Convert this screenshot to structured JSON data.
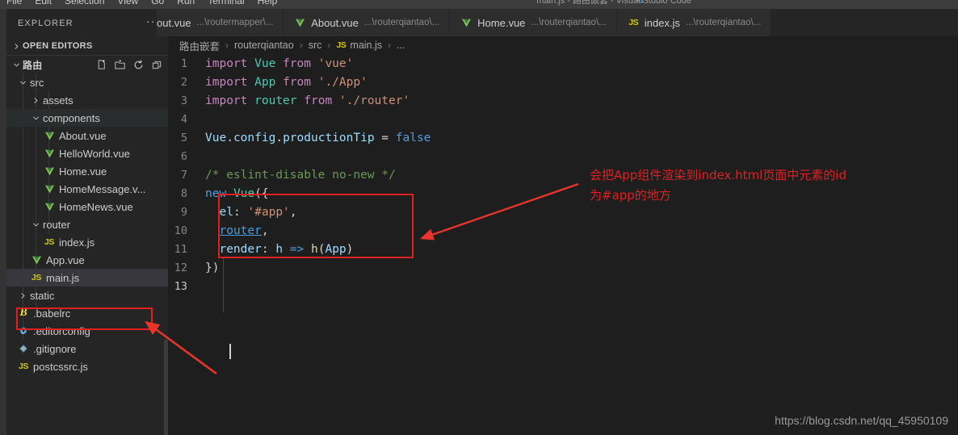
{
  "menubar": {
    "items": [
      "File",
      "Edit",
      "Selection",
      "View",
      "Go",
      "Run",
      "Terminal",
      "Help"
    ],
    "window_title": "main.js - 路由嵌套 - Visual Studio Code"
  },
  "sidebar": {
    "title": "EXPLORER",
    "more_actions": "···",
    "sections": [
      {
        "label": "OPEN EDITORS",
        "expanded": false
      },
      {
        "label": "路由",
        "expanded": true
      }
    ],
    "toolbar": [
      {
        "name": "new-file-icon",
        "tooltip": "New File"
      },
      {
        "name": "new-folder-icon",
        "tooltip": "New Folder"
      },
      {
        "name": "refresh-icon",
        "tooltip": "Refresh Explorer"
      },
      {
        "name": "collapse-all-icon",
        "tooltip": "Collapse Folders in Explorer"
      }
    ],
    "tree": [
      {
        "label": "src",
        "type": "folder",
        "state": "expanded",
        "indent": 1,
        "icon": "chevron-down-icon",
        "selected": false
      },
      {
        "label": "assets",
        "type": "folder",
        "state": "collapsed",
        "indent": 2,
        "icon": "chevron-right-icon",
        "selected": false
      },
      {
        "label": "components",
        "type": "folder",
        "state": "expanded",
        "indent": 2,
        "icon": "chevron-down-icon",
        "selected": false,
        "hover": true
      },
      {
        "label": "About.vue",
        "type": "file",
        "indent": 3,
        "icon": "vue-icon",
        "selected": false
      },
      {
        "label": "HelloWorld.vue",
        "type": "file",
        "indent": 3,
        "icon": "vue-icon",
        "selected": false
      },
      {
        "label": "Home.vue",
        "type": "file",
        "indent": 3,
        "icon": "vue-icon",
        "selected": false
      },
      {
        "label": "HomeMessage.v...",
        "type": "file",
        "indent": 3,
        "icon": "vue-icon",
        "selected": false
      },
      {
        "label": "HomeNews.vue",
        "type": "file",
        "indent": 3,
        "icon": "vue-icon",
        "selected": false
      },
      {
        "label": "router",
        "type": "folder",
        "state": "expanded",
        "indent": 2,
        "icon": "chevron-down-icon",
        "selected": false
      },
      {
        "label": "index.js",
        "type": "file",
        "indent": 3,
        "icon": "js-icon",
        "selected": false
      },
      {
        "label": "App.vue",
        "type": "file",
        "indent": 2,
        "icon": "vue-icon",
        "selected": false
      },
      {
        "label": "main.js",
        "type": "file",
        "indent": 2,
        "icon": "js-icon",
        "selected": true
      },
      {
        "label": "static",
        "type": "folder",
        "state": "collapsed",
        "indent": 1,
        "icon": "chevron-right-icon",
        "selected": false
      },
      {
        "label": ".babelrc",
        "type": "file",
        "indent": 1,
        "icon": "babel-icon",
        "selected": false
      },
      {
        "label": ".editorconfig",
        "type": "file",
        "indent": 1,
        "icon": "editorconfig-icon",
        "selected": false
      },
      {
        "label": ".gitignore",
        "type": "file",
        "indent": 1,
        "icon": "git-icon",
        "selected": false
      },
      {
        "label": "postcssrc.js",
        "type": "file",
        "indent": 1,
        "icon": "js-icon",
        "selected": false
      }
    ]
  },
  "editor": {
    "tabs": [
      {
        "name": "out.vue",
        "path": "...\\routermapper\\...",
        "icon": "vue-icon",
        "active": false,
        "clipped": true
      },
      {
        "name": "About.vue",
        "path": "...\\routerqiantao\\...",
        "icon": "vue-icon",
        "active": false
      },
      {
        "name": "Home.vue",
        "path": "...\\routerqiantao\\...",
        "icon": "vue-icon",
        "active": false
      },
      {
        "name": "index.js",
        "path": "...\\routerqiantao\\...",
        "icon": "js-icon",
        "active": false
      }
    ],
    "breadcrumb": [
      {
        "label": "路由嵌套",
        "icon": null
      },
      {
        "label": "routerqiantao",
        "icon": null
      },
      {
        "label": "src",
        "icon": null
      },
      {
        "label": "main.js",
        "icon": "js-icon"
      },
      {
        "label": "...",
        "icon": null
      }
    ],
    "breadcrumb_separator": "›",
    "line_numbers": [
      "1",
      "2",
      "3",
      "4",
      "5",
      "6",
      "7",
      "8",
      "9",
      "10",
      "11",
      "12",
      "13"
    ],
    "current_line": 13,
    "lines": [
      [
        {
          "t": "import",
          "c": "t-kw"
        },
        {
          "t": " ",
          "c": "t-pun"
        },
        {
          "t": "Vue",
          "c": "t-cls"
        },
        {
          "t": " ",
          "c": "t-pun"
        },
        {
          "t": "from",
          "c": "t-kw"
        },
        {
          "t": " ",
          "c": "t-pun"
        },
        {
          "t": "'vue'",
          "c": "t-str"
        }
      ],
      [
        {
          "t": "import",
          "c": "t-kw"
        },
        {
          "t": " ",
          "c": "t-pun"
        },
        {
          "t": "App",
          "c": "t-cls"
        },
        {
          "t": " ",
          "c": "t-pun"
        },
        {
          "t": "from",
          "c": "t-kw"
        },
        {
          "t": " ",
          "c": "t-pun"
        },
        {
          "t": "'./App'",
          "c": "t-str"
        }
      ],
      [
        {
          "t": "import",
          "c": "t-kw"
        },
        {
          "t": " ",
          "c": "t-pun"
        },
        {
          "t": "router",
          "c": "t-cls"
        },
        {
          "t": " ",
          "c": "t-pun"
        },
        {
          "t": "from",
          "c": "t-kw"
        },
        {
          "t": " ",
          "c": "t-pun"
        },
        {
          "t": "'./router'",
          "c": "t-str"
        }
      ],
      [],
      [
        {
          "t": "Vue",
          "c": "t-id"
        },
        {
          "t": ".",
          "c": "t-pun"
        },
        {
          "t": "config",
          "c": "t-id"
        },
        {
          "t": ".",
          "c": "t-pun"
        },
        {
          "t": "productionTip",
          "c": "t-id"
        },
        {
          "t": " = ",
          "c": "t-pun"
        },
        {
          "t": "false",
          "c": "t-kw2"
        }
      ],
      [],
      [
        {
          "t": "/* eslint-disable no-new */",
          "c": "t-cmt"
        }
      ],
      [
        {
          "t": "new",
          "c": "t-kw2"
        },
        {
          "t": " ",
          "c": "t-pun"
        },
        {
          "t": "Vue",
          "c": "t-cls"
        },
        {
          "t": "({",
          "c": "t-pun"
        }
      ],
      [
        {
          "t": "  ",
          "c": "t-pun"
        },
        {
          "t": "el",
          "c": "t-prop"
        },
        {
          "t": ": ",
          "c": "t-pun"
        },
        {
          "t": "'#app'",
          "c": "t-str"
        },
        {
          "t": ",",
          "c": "t-pun"
        }
      ],
      [
        {
          "t": "  ",
          "c": "t-pun"
        },
        {
          "t": "router",
          "c": "t-link"
        },
        {
          "t": ",",
          "c": "t-pun"
        }
      ],
      [
        {
          "t": "  ",
          "c": "t-pun"
        },
        {
          "t": "render",
          "c": "t-prop"
        },
        {
          "t": ": ",
          "c": "t-pun"
        },
        {
          "t": "h",
          "c": "t-id"
        },
        {
          "t": " ",
          "c": "t-pun"
        },
        {
          "t": "=>",
          "c": "t-kw2"
        },
        {
          "t": " ",
          "c": "t-pun"
        },
        {
          "t": "h",
          "c": "t-fn"
        },
        {
          "t": "(",
          "c": "t-pun"
        },
        {
          "t": "App",
          "c": "t-id"
        },
        {
          "t": ")",
          "c": "t-pun"
        }
      ],
      [
        {
          "t": "})",
          "c": "t-pun"
        }
      ],
      []
    ]
  },
  "annotations": {
    "render_note": "会把App组件渲染到index.html页面中元素的id\n为#app的地方",
    "highlight_code_block": "el / router / render options",
    "highlight_file": "main.js",
    "arrow_color": "#e8352b",
    "box_color": "#e02020"
  },
  "watermark": "https://blog.csdn.net/qq_45950109",
  "colors": {
    "editor_bg": "#1e1e1e",
    "sidebar_bg": "#252526",
    "tabbar_bg": "#252526",
    "tab_inactive_bg": "#2d2d2d",
    "menubar_bg": "#3c3c3c",
    "selection_bg": "#37373d",
    "accent_red": "#e02020",
    "vue_green": "#80c454",
    "js_yellow": "#d5c900"
  }
}
